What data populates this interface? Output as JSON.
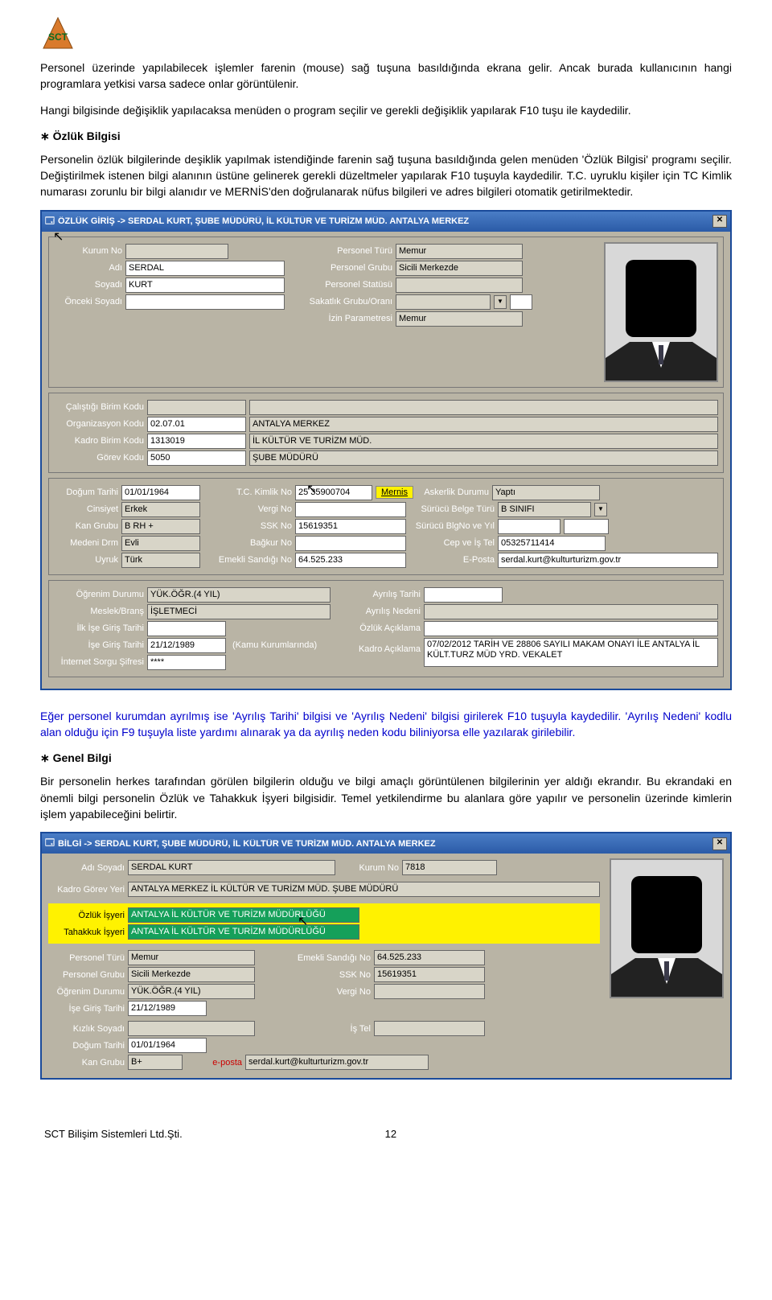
{
  "page": {
    "footer_company": "SCT Bilişim Sistemleri Ltd.Şti.",
    "footer_page": "12"
  },
  "text": {
    "p1": "Personel üzerinde yapılabilecek işlemler farenin (mouse) sağ tuşuna basıldığında ekrana gelir. Ancak burada kullanıcının hangi programlara yetkisi varsa sadece onlar görüntülenir.",
    "p2": "Hangi bilgisinde değişiklik yapılacaksa menüden o program seçilir ve gerekli değişiklik yapılarak F10 tuşu ile kaydedilir.",
    "h1": "Özlük Bilgisi",
    "p3": "Personelin özlük bilgilerinde deşiklik yapılmak istendiğinde farenin sağ tuşuna basıldığında gelen menüden 'Özlük Bilgisi' programı seçilir. Değiştirilmek istenen bilgi alanının üstüne gelinerek gerekli düzeltmeler yapılarak F10 tuşuyla kaydedilir. T.C. uyruklu kişiler için TC Kimlik numarası zorunlu bir bilgi alanıdır ve MERNİS'den doğrulanarak nüfus bilgileri ve adres bilgileri otomatik getirilmektedir.",
    "p4": "Eğer personel kurumdan ayrılmış ise 'Ayrılış Tarihi' bilgisi ve 'Ayrılış Nedeni' bilgisi girilerek F10 tuşuyla kaydedilir. 'Ayrılış Nedeni' kodlu alan olduğu için F9 tuşuyla liste yardımı alınarak ya da ayrılış neden kodu biliniyorsa elle yazılarak girilebilir.",
    "h2": "Genel Bilgi",
    "p5": "Bir personelin herkes tarafından görülen bilgilerin olduğu ve bilgi amaçlı görüntülenen bilgilerinin yer aldığı ekrandır. Bu ekrandaki en önemli bilgi personelin Özlük ve Tahakkuk İşyeri bilgisidir. Temel yetkilendirme bu alanlara göre yapılır ve personelin üzerinde kimlerin işlem yapabileceğini belirtir."
  },
  "win1": {
    "title": "ÖZLÜK GİRİŞ -> SERDAL KURT, ŞUBE MÜDÜRÜ, İL KÜLTÜR VE TURİZM MÜD. ANTALYA MERKEZ",
    "labels": {
      "kurum_no": "Kurum No",
      "adi": "Adı",
      "soyadi": "Soyadı",
      "onceki_soyadi": "Önceki Soyadı",
      "personel_turu": "Personel Türü",
      "personel_grubu": "Personel Grubu",
      "personel_statusu": "Personel Statüsü",
      "sakatlik": "Sakatlık Grubu/Oranı",
      "izin_param": "İzin Parametresi",
      "calistigi_birim": "Çalıştığı Birim Kodu",
      "org_kodu": "Organizasyon Kodu",
      "kadro_birim": "Kadro Birim Kodu",
      "gorev_kodu": "Görev Kodu",
      "dogum_tarihi": "Doğum Tarihi",
      "cinsiyet": "Cinsiyet",
      "kan_grubu": "Kan Grubu",
      "medeni_drm": "Medeni Drm",
      "uyruk": "Uyruk",
      "tc_kimlik": "T.C. Kimlik No",
      "vergi_no": "Vergi No",
      "ssk_no": "SSK No",
      "bagkur_no": "Bağkur No",
      "emekli_sandigi": "Emekli Sandığı No",
      "mernis": "Mernis",
      "askerlik": "Askerlik Durumu",
      "surucu_belge": "Sürücü Belge Türü",
      "surucu_blgno": "Sürücü BlgNo ve Yıl",
      "cep_is_tel": "Cep ve İş Tel",
      "eposta": "E-Posta",
      "ogrenim": "Öğrenim Durumu",
      "meslek": "Meslek/Branş",
      "ilk_ise_giris": "İlk İşe Giriş Tarihi",
      "ise_giris": "İşe Giriş Tarihi",
      "internet_sorgu": "İnternet Sorgu Şifresi",
      "ayrilis_tarihi": "Ayrılış Tarihi",
      "ayrilis_nedeni": "Ayrılış Nedeni",
      "ozluk_aciklama": "Özlük Açıklama",
      "kadro_aciklama": "Kadro Açıklama",
      "kamu_kurum": "(Kamu Kurumlarında)"
    },
    "values": {
      "adi": "SERDAL",
      "soyadi": "KURT",
      "personel_turu": "Memur",
      "personel_grubu": "Sicili Merkezde",
      "izin_param": "Memur",
      "org_kodu": "02.07.01",
      "org_adi": "ANTALYA MERKEZ",
      "kadro_birim": "1313019",
      "kadro_birim_adi": "İL KÜLTÜR VE TURİZM MÜD.",
      "gorev_kodu": "5050",
      "gorev_adi": "ŞUBE MÜDÜRÜ",
      "dogum_tarihi": "01/01/1964",
      "tc_kimlik": "25 35900704",
      "askerlik": "Yaptı",
      "cinsiyet": "Erkek",
      "surucu_belge": "B SINIFI",
      "kan_grubu": "B RH +",
      "ssk_no": "15619351",
      "medeni_drm": "Evli",
      "cep_tel": "05325711414",
      "uyruk": "Türk",
      "emekli_sandigi": "64.525.233",
      "eposta": "serdal.kurt@kulturturizm.gov.tr",
      "ogrenim": "YÜK.ÖĞR.(4 YIL)",
      "meslek": "İŞLETMECİ",
      "ise_giris": "21/12/1989",
      "internet_sorgu": "****",
      "kadro_aciklama": "07/02/2012 TARİH VE 28806 SAYILI MAKAM ONAYI İLE ANTALYA İL KÜLT.TURZ MÜD YRD. VEKALET"
    }
  },
  "win2": {
    "title": "BİLGİ -> SERDAL KURT, ŞUBE MÜDÜRÜ, İL KÜLTÜR VE TURİZM MÜD. ANTALYA MERKEZ",
    "labels": {
      "adi_soyadi": "Adı Soyadı",
      "kurum_no": "Kurum No",
      "kadro_gorev": "Kadro Görev Yeri",
      "ozluk_isyeri": "Özlük İşyeri",
      "tahakkuk_isyeri": "Tahakkuk İşyeri",
      "personel_turu": "Personel Türü",
      "personel_grubu": "Personel Grubu",
      "ogrenim": "Öğrenim Durumu",
      "ise_giris": "İşe Giriş Tarihi",
      "emekli_sandigi": "Emekli Sandığı No",
      "ssk_no": "SSK No",
      "vergi_no": "Vergi No",
      "kizlik_soyadi": "Kızlık Soyadı",
      "dogum_tarihi": "Doğum Tarihi",
      "kan_grubu": "Kan Grubu",
      "is_tel": "İş Tel",
      "eposta": "e-posta"
    },
    "values": {
      "adi_soyadi": "SERDAL KURT",
      "kurum_no": "7818",
      "kadro_gorev": "ANTALYA MERKEZ İL KÜLTÜR VE TURİZM MÜD.  ŞUBE MÜDÜRÜ",
      "ozluk_isyeri": "ANTALYA İL KÜLTÜR VE TURİZM MÜDÜRLÜĞÜ",
      "tahakkuk_isyeri": "ANTALYA İL KÜLTÜR VE TURİZM MÜDÜRLÜĞÜ",
      "personel_turu": "Memur",
      "personel_grubu": "Sicili Merkezde",
      "ogrenim": "YÜK.ÖĞR.(4 YIL)",
      "ise_giris": "21/12/1989",
      "emekli_sandigi": "64.525.233",
      "ssk_no": "15619351",
      "dogum_tarihi": "01/01/1964",
      "kan_grubu": "B+",
      "eposta": "serdal.kurt@kulturturizm.gov.tr"
    }
  }
}
